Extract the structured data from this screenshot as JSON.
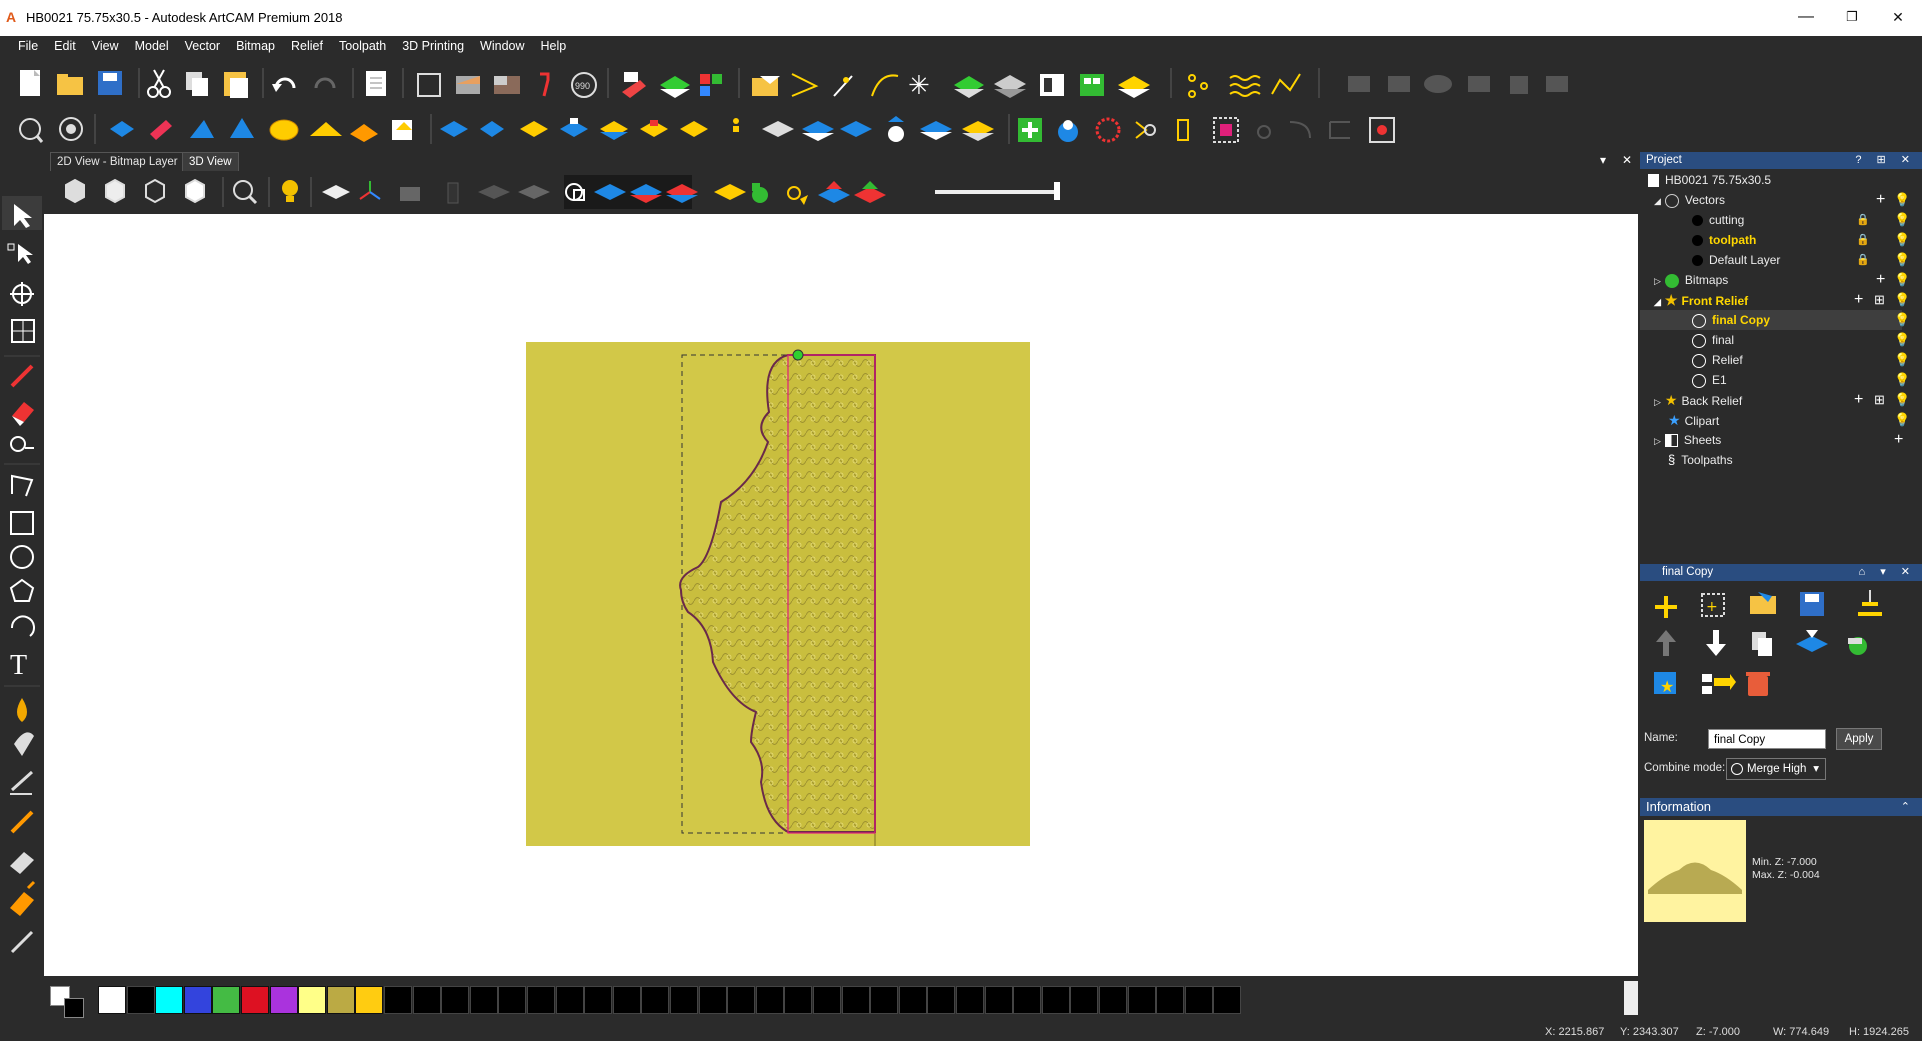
{
  "window": {
    "title": "HB0021 75.75x30.5 - Autodesk ArtCAM Premium 2018",
    "minimize": "—",
    "maximize": "❐",
    "close": "✕"
  },
  "menu": [
    "File",
    "Edit",
    "View",
    "Model",
    "Vector",
    "Bitmap",
    "Relief",
    "Toolpath",
    "3D Printing",
    "Window",
    "Help"
  ],
  "tabs": [
    "2D View - Bitmap Layer",
    "3D View"
  ],
  "tab_controls": {
    "dropdown": "▾",
    "close": "✕"
  },
  "project": {
    "header": "Project",
    "header_controls": "? ⊞ ✕",
    "file": "HB0021 75.75x30.5",
    "vectors": {
      "label": "Vectors",
      "layers": [
        "cutting",
        "toolpath",
        "Default Layer"
      ]
    },
    "bitmaps": "Bitmaps",
    "front_relief": {
      "label": "Front Relief",
      "layers": [
        "final Copy",
        "final",
        "Relief",
        "E1"
      ]
    },
    "back_relief": "Back Relief",
    "clipart": "Clipart",
    "sheets": "Sheets",
    "toolpaths": "Toolpaths"
  },
  "layer_panel": {
    "header": "final Copy",
    "header_controls": "⌂ ▾ ✕",
    "name_label": "Name:",
    "name_value": "final Copy",
    "apply": "Apply",
    "combine_label": "Combine mode:",
    "combine_value": "Merge High",
    "combine_arrow": "▾"
  },
  "information": {
    "header": "Information",
    "collapse": "⌃",
    "min_z": "Min. Z: -7.000",
    "max_z": "Max. Z: -0.004"
  },
  "status": {
    "x": "X: 2215.867",
    "y": "Y: 2343.307",
    "z": "Z: -7.000",
    "w": "W: 774.649",
    "h": "H: 1924.265"
  },
  "palette_colors": [
    "#ffffff",
    "#000000",
    "#00ffff",
    "#3344dd",
    "#44bb44",
    "#dd1122",
    "#aa33dd",
    "#ffff88",
    "#bbaa44",
    "#ffcc11",
    "#000000",
    "#000000",
    "#000000",
    "#000000",
    "#000000",
    "#000000",
    "#000000",
    "#000000",
    "#000000",
    "#000000",
    "#000000",
    "#000000",
    "#000000",
    "#000000",
    "#000000",
    "#000000",
    "#000000",
    "#000000",
    "#000000",
    "#000000",
    "#000000",
    "#000000",
    "#000000",
    "#000000",
    "#000000",
    "#000000",
    "#000000",
    "#000000",
    "#000000",
    "#000000"
  ],
  "colors": {
    "accent": "#2a4d80",
    "canvas": "#d2c848",
    "selection": "#e0207a",
    "bulb": "#f2c000"
  }
}
